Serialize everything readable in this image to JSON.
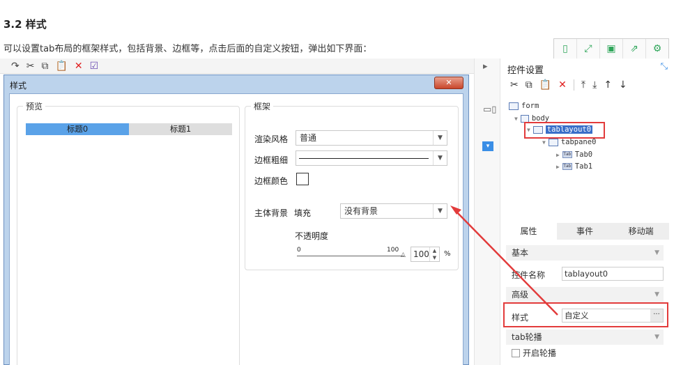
{
  "doc": {
    "heading": "3.2 样式",
    "description": "可以设置tab布局的框架样式，包括背景、边框等，点击后面的自定义按钮，弹出如下界面："
  },
  "top_icons": [
    "tablet-icon",
    "fullscreen-icon",
    "save-icon",
    "export-icon",
    "settings-icon"
  ],
  "dialog": {
    "title": "样式",
    "close": "✕",
    "preview": {
      "legend": "预览",
      "tabs": [
        "标题0",
        "标题1"
      ]
    },
    "frame": {
      "legend": "框架",
      "render_style_label": "渲染风格",
      "render_style_value": "普通",
      "border_width_label": "边框粗细",
      "border_color_label": "边框颜色",
      "bg_label": "主体背景",
      "fill_label": "填充",
      "bg_value": "没有背景",
      "opacity_label": "不透明度",
      "slider_min": "0",
      "slider_max": "100",
      "opacity_value": "100",
      "percent": "%"
    }
  },
  "panel": {
    "title": "控件设置",
    "tree": {
      "form": "form",
      "body": "body",
      "tablayout": "tablayout0",
      "tabpane": "tabpane0",
      "tab0": "Tab0",
      "tab1": "Tab1",
      "tab_icon_text": "Tab"
    },
    "tabs": [
      "属性",
      "事件",
      "移动端"
    ],
    "groups": {
      "basic": "基本",
      "advanced": "高级",
      "carousel": "tab轮播"
    },
    "props": {
      "name_label": "控件名称",
      "name_value": "tablayout0",
      "style_label": "样式",
      "style_value": "自定义",
      "dots": "···",
      "carousel_label": "开启轮播"
    }
  },
  "colors": {
    "accent": "#3a8ee6",
    "highlight": "#e23b3b",
    "icon_green": "#2fa65a"
  }
}
